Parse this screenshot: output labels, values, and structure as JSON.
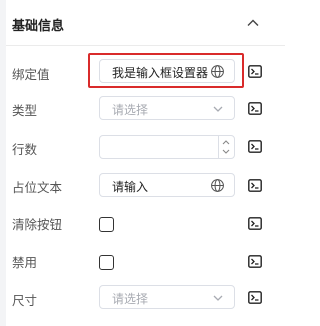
{
  "header": {
    "title": "基础信息",
    "collapse_icon": "chevron-up-icon"
  },
  "rows": {
    "binding": {
      "label": "绑定值",
      "value": "我是输入框设置器",
      "icon": "globe-icon"
    },
    "type": {
      "label": "类型",
      "placeholder": "请选择"
    },
    "rows_count": {
      "label": "行数",
      "value": ""
    },
    "placeholder": {
      "label": "占位文本",
      "value": "请输入",
      "icon": "globe-icon"
    },
    "clearable": {
      "label": "清除按钮",
      "checked": false
    },
    "disabled": {
      "label": "禁用",
      "checked": false
    },
    "size": {
      "label": "尺寸",
      "placeholder": "请选择"
    }
  },
  "expression_icon": "terminal-expression-icon",
  "colors": {
    "highlight": "#d92b2b",
    "border": "#dcdfe6",
    "placeholder": "#a8abb2"
  }
}
